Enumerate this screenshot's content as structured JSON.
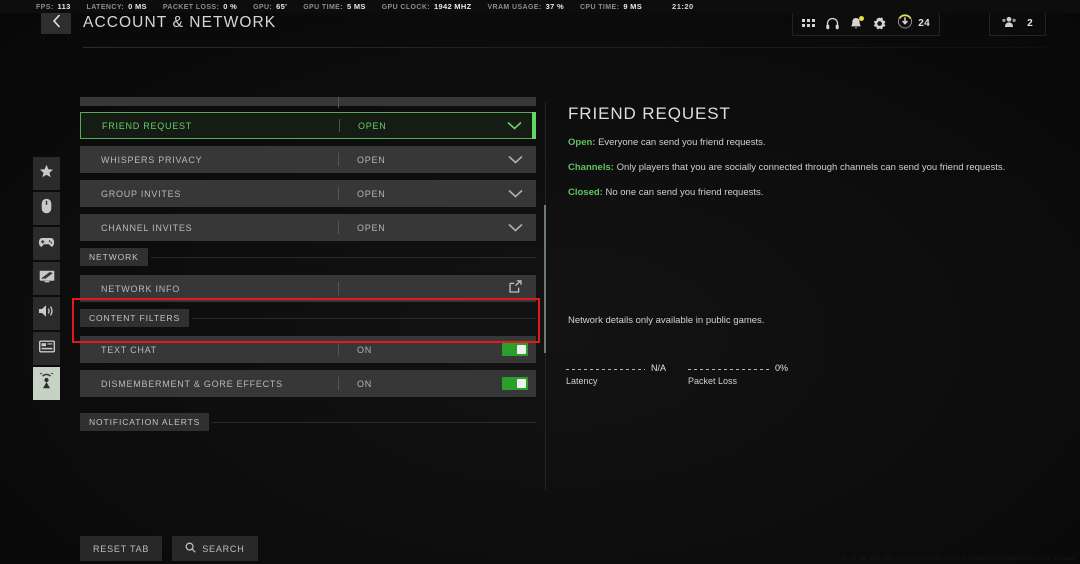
{
  "perf": {
    "items": [
      {
        "label": "FPS:",
        "value": "113"
      },
      {
        "label": "LATENCY:",
        "value": "0 MS"
      },
      {
        "label": "PACKET LOSS:",
        "value": "0 %"
      },
      {
        "label": "GPU:",
        "value": "65'"
      },
      {
        "label": "GPU TIME:",
        "value": "5 MS"
      },
      {
        "label": "GPU CLOCK:",
        "value": "1942 MHZ"
      },
      {
        "label": "VRAM USAGE:",
        "value": "37 %"
      },
      {
        "label": "CPU TIME:",
        "value": "9 MS"
      }
    ],
    "clock": "21:20"
  },
  "header": {
    "title": "ACCOUNT & NETWORK",
    "back_icon": "chevron-left-icon",
    "icons": [
      "apps-grid-icon",
      "headset-icon",
      "bell-icon",
      "gear-icon"
    ],
    "rank_value": "24",
    "party_value": "2"
  },
  "rail": {
    "items": [
      {
        "name": "sidebar-item-favorites",
        "icon": "star-icon",
        "active": false
      },
      {
        "name": "sidebar-item-mouse",
        "icon": "mouse-icon",
        "active": false
      },
      {
        "name": "sidebar-item-controller",
        "icon": "gamepad-icon",
        "active": false
      },
      {
        "name": "sidebar-item-graphics",
        "icon": "display-icon",
        "active": false
      },
      {
        "name": "sidebar-item-audio",
        "icon": "speaker-icon",
        "active": false
      },
      {
        "name": "sidebar-item-interface",
        "icon": "hud-icon",
        "active": false
      },
      {
        "name": "sidebar-item-account-network",
        "icon": "network-icon",
        "active": true
      }
    ]
  },
  "settings": {
    "rows": [
      {
        "label": "FRIEND REQUEST",
        "value": "OPEN",
        "control": "dropdown",
        "selected": true
      },
      {
        "label": "WHISPERS PRIVACY",
        "value": "OPEN",
        "control": "dropdown",
        "selected": false
      },
      {
        "label": "GROUP INVITES",
        "value": "OPEN",
        "control": "dropdown",
        "selected": false
      },
      {
        "label": "CHANNEL INVITES",
        "value": "OPEN",
        "control": "dropdown",
        "selected": false
      }
    ],
    "section_network": "NETWORK",
    "network_row": {
      "label": "NETWORK INFO",
      "value": "",
      "control": "external-link"
    },
    "section_content_filters": "CONTENT FILTERS",
    "filter_rows": [
      {
        "label": "TEXT CHAT",
        "value": "ON",
        "control": "toggle",
        "on": true
      },
      {
        "label": "DISMEMBERMENT & GORE EFFECTS",
        "value": "ON",
        "control": "toggle",
        "on": true
      }
    ],
    "section_notification_alerts": "NOTIFICATION ALERTS"
  },
  "detail": {
    "title": "FRIEND REQUEST",
    "lines": [
      {
        "term": "Open:",
        "text": " Everyone can send you friend requests."
      },
      {
        "term": "Channels:",
        "text": " Only players that you are socially connected through channels can send you friend requests."
      },
      {
        "term": "Closed:",
        "text": " No one can send you friend requests."
      }
    ],
    "network_note": "Network details only available in public games.",
    "meters": [
      {
        "label": "Latency",
        "value": "N/A"
      },
      {
        "label": "Packet Loss",
        "value": "0%"
      }
    ]
  },
  "footer": {
    "reset_label": "RESET TAB",
    "search_label": "SEARCH",
    "search_icon": "search-icon",
    "build_text": "0.35.10.14E.188.[358.193.2418->11].T.[7000][110T3690361197-v] C-base"
  },
  "colors": {
    "accent_green": "#63d663",
    "toggle_green": "#2aa02a",
    "annotation_red": "#e01b1b",
    "notif_yellow": "#e8de3c"
  }
}
